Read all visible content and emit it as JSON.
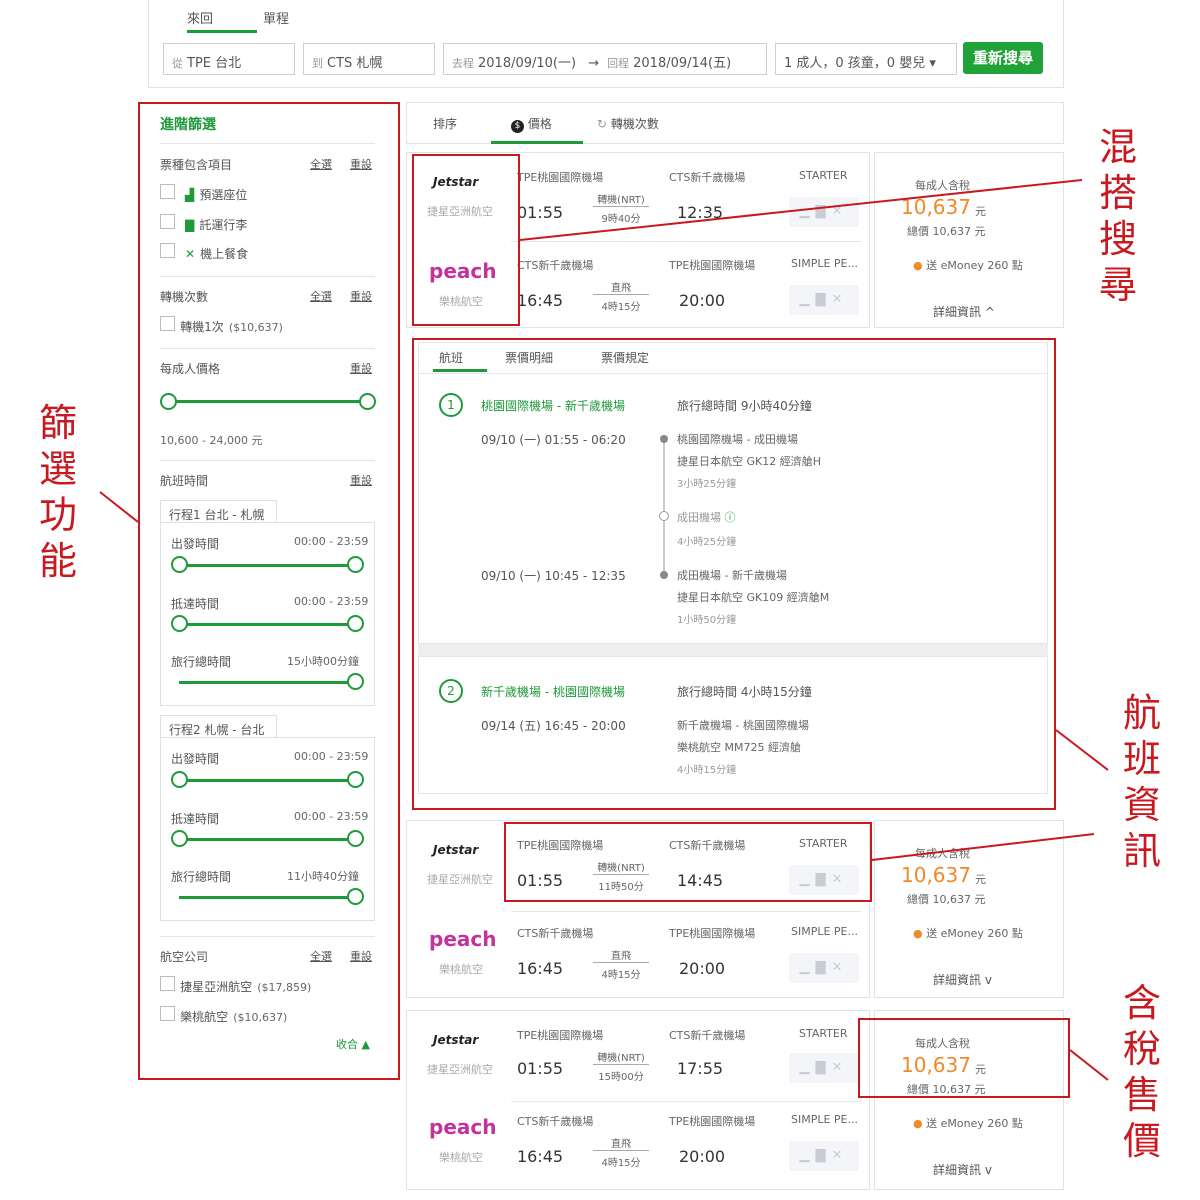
{
  "search": {
    "tab_round": "來回",
    "tab_oneway": "單程",
    "from_prefix": "從",
    "from_value": "TPE 台北",
    "to_prefix": "到",
    "to_value": "CTS 札幌",
    "depart_prefix": "去程",
    "depart_value": "2018/09/10(一)",
    "arrow": "→",
    "return_prefix": "回程",
    "return_value": "2018/09/14(五)",
    "passengers": "1 成人，0 孩童，0 嬰兒",
    "search_button": "重新搜尋"
  },
  "filters": {
    "title": "進階篩選",
    "select_all": "全選",
    "reset": "重設",
    "collapse": "收合 ▲",
    "ticket_section": "票種包含項目",
    "ticket_items": [
      "預選座位",
      "託運行李",
      "機上餐食"
    ],
    "stops_section": "轉機次數",
    "stops_item": "轉機1次",
    "stops_price": "($10,637)",
    "price_section": "每成人價格",
    "price_range": "10,600 - 24,000 元",
    "time_section": "航班時間",
    "leg1_title": "行程1 台北 - 札幌",
    "leg2_title": "行程2 札幌 - 台北",
    "depart_time": "出發時間",
    "arrive_time": "抵達時間",
    "total_time": "旅行總時間",
    "time_range": "00:00 - 23:59",
    "leg1_total": "15小時00分鐘",
    "leg2_total": "11小時40分鐘",
    "airline_section": "航空公司",
    "airlines": [
      {
        "name": "捷星亞洲航空",
        "price": "($17,859)"
      },
      {
        "name": "樂桃航空",
        "price": "($10,637)"
      }
    ]
  },
  "sort": {
    "label": "排序",
    "price": "價格",
    "transfers": "轉機次數"
  },
  "results": [
    {
      "out": {
        "logo": "Jetstar",
        "airline": "捷星亞洲航空",
        "dep_airport": "TPE桃園國際機場",
        "dep_time": "01:55",
        "via": "轉機(NRT)",
        "duration": "9時40分",
        "arr_airport": "CTS新千歲機場",
        "arr_time": "12:35",
        "fare": "STARTER"
      },
      "back": {
        "logo": "peach",
        "airline": "樂桃航空",
        "dep_airport": "CTS新千歲機場",
        "dep_time": "16:45",
        "via": "直飛",
        "duration": "4時15分",
        "arr_airport": "TPE桃園國際機場",
        "arr_time": "20:00",
        "fare": "SIMPLE PE..."
      },
      "price_label": "每成人含稅",
      "price": "10,637",
      "unit": "元",
      "total": "總價 10,637 元",
      "emoney": "送 eMoney 260 點",
      "details": "詳細資訊 ^"
    },
    {
      "out": {
        "logo": "Jetstar",
        "airline": "捷星亞洲航空",
        "dep_airport": "TPE桃園國際機場",
        "dep_time": "01:55",
        "via": "轉機(NRT)",
        "duration": "11時50分",
        "arr_airport": "CTS新千歲機場",
        "arr_time": "14:45",
        "fare": "STARTER"
      },
      "back": {
        "logo": "peach",
        "airline": "樂桃航空",
        "dep_airport": "CTS新千歲機場",
        "dep_time": "16:45",
        "via": "直飛",
        "duration": "4時15分",
        "arr_airport": "TPE桃園國際機場",
        "arr_time": "20:00",
        "fare": "SIMPLE PE..."
      },
      "price_label": "每成人含稅",
      "price": "10,637",
      "unit": "元",
      "total": "總價 10,637 元",
      "emoney": "送 eMoney 260 點",
      "details": "詳細資訊 v"
    },
    {
      "out": {
        "logo": "Jetstar",
        "airline": "捷星亞洲航空",
        "dep_airport": "TPE桃園國際機場",
        "dep_time": "01:55",
        "via": "轉機(NRT)",
        "duration": "15時00分",
        "arr_airport": "CTS新千歲機場",
        "arr_time": "17:55",
        "fare": "STARTER"
      },
      "back": {
        "logo": "peach",
        "airline": "樂桃航空",
        "dep_airport": "CTS新千歲機場",
        "dep_time": "16:45",
        "via": "直飛",
        "duration": "4時15分",
        "arr_airport": "TPE桃園國際機場",
        "arr_time": "20:00",
        "fare": "SIMPLE PE..."
      },
      "price_label": "每成人含稅",
      "price": "10,637",
      "unit": "元",
      "total": "總價 10,637 元",
      "emoney": "送 eMoney 260 點",
      "details": "詳細資訊 v"
    }
  ],
  "detail": {
    "tabs": [
      "航班",
      "票價明細",
      "票價規定"
    ],
    "leg1": {
      "num": "1",
      "route": "桃園國際機場 - 新千歲機場",
      "total": "旅行總時間 9小時40分鐘",
      "seg1_time": "09/10 (一) 01:55 - 06:20",
      "seg1_route": "桃園國際機場 - 成田機場",
      "seg1_flight": "捷星日本航空 GK12 經濟艙H",
      "seg1_dur": "3小時25分鐘",
      "layover": "成田機場",
      "layover_dur": "4小時25分鐘",
      "seg2_time": "09/10 (一) 10:45 - 12:35",
      "seg2_route": "成田機場 - 新千歲機場",
      "seg2_flight": "捷星日本航空 GK109 經濟艙M",
      "seg2_dur": "1小時50分鐘"
    },
    "leg2": {
      "num": "2",
      "route": "新千歲機場 - 桃園國際機場",
      "total": "旅行總時間 4小時15分鐘",
      "seg_time": "09/14 (五) 16:45 - 20:00",
      "seg_route": "新千歲機場 - 桃園國際機場",
      "seg_flight": "樂桃航空 MM725 經濟艙",
      "seg_dur": "4小時15分鐘"
    }
  },
  "annotations": {
    "mix": "混搭搜尋",
    "filter": "篩選功能",
    "flight_info": "航班資訊",
    "tax_price": "含稅售價"
  },
  "colors": {
    "accent": "#1f9a3a",
    "annotation": "#c8191f",
    "price": "#ef8a2a"
  }
}
